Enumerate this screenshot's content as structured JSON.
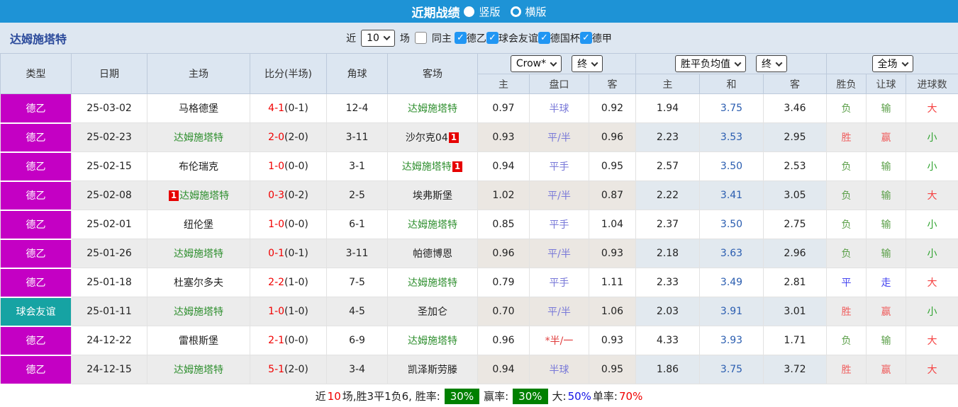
{
  "title_bar": {
    "title": "近期战绩",
    "layout_options": [
      {
        "label": "竖版",
        "selected": true
      },
      {
        "label": "横版",
        "selected": false
      }
    ]
  },
  "filter_bar": {
    "team": "达姆施塔特",
    "recent_label": "近",
    "recent_count": "10",
    "matches_label": "场",
    "same_home_label": "同主",
    "same_home_checked": false,
    "leagues": [
      {
        "label": "德乙",
        "checked": true
      },
      {
        "label": "球会友谊",
        "checked": true
      },
      {
        "label": "德国杯",
        "checked": true
      },
      {
        "label": "德甲",
        "checked": true
      }
    ]
  },
  "table": {
    "headers": {
      "type": "类型",
      "date": "日期",
      "home": "主场",
      "score": "比分(半场)",
      "corner": "角球",
      "away": "客场",
      "odds_company_select": "Crow*",
      "odds_final_select": "终",
      "odds_home": "主",
      "odds_handicap": "盘口",
      "odds_away": "客",
      "avg_select": "胜平负均值",
      "avg_final_select": "终",
      "avg_home": "主",
      "avg_draw": "和",
      "avg_away": "客",
      "result": "胜负",
      "handicap_result": "让球",
      "goals": "进球数",
      "goals_scope_select": "全场"
    },
    "rows": [
      {
        "league": "德乙",
        "league_color": "#c400c4",
        "date": "25-03-02",
        "home": {
          "name": "马格德堡",
          "selected": false,
          "badge": "",
          "badge_pos": ""
        },
        "score_ft": "4-1",
        "score_ht": "(0-1)",
        "corner": "12-4",
        "away": {
          "name": "达姆施塔特",
          "selected": true,
          "badge": "",
          "badge_pos": ""
        },
        "odds": {
          "home": "0.97",
          "handicap": "半球",
          "handicap_red": false,
          "away": "0.92"
        },
        "avg": {
          "home": "1.94",
          "draw": "3.75",
          "away": "3.46"
        },
        "result": {
          "text": "负",
          "color": "green"
        },
        "handicap_result": {
          "text": "输",
          "color": "green"
        },
        "goals": {
          "text": "大",
          "color": "red"
        }
      },
      {
        "league": "德乙",
        "league_color": "#c400c4",
        "date": "25-02-23",
        "home": {
          "name": "达姆施塔特",
          "selected": true,
          "badge": "",
          "badge_pos": ""
        },
        "score_ft": "2-0",
        "score_ht": "(2-0)",
        "corner": "3-11",
        "away": {
          "name": "沙尔克04",
          "selected": false,
          "badge": "1",
          "badge_pos": "after"
        },
        "odds": {
          "home": "0.93",
          "handicap": "平/半",
          "handicap_red": false,
          "away": "0.96"
        },
        "avg": {
          "home": "2.23",
          "draw": "3.53",
          "away": "2.95"
        },
        "result": {
          "text": "胜",
          "color": "red"
        },
        "handicap_result": {
          "text": "赢",
          "color": "red"
        },
        "goals": {
          "text": "小",
          "color": "green"
        }
      },
      {
        "league": "德乙",
        "league_color": "#c400c4",
        "date": "25-02-15",
        "home": {
          "name": "布伦瑞克",
          "selected": false,
          "badge": "",
          "badge_pos": ""
        },
        "score_ft": "1-0",
        "score_ht": "(0-0)",
        "corner": "3-1",
        "away": {
          "name": "达姆施塔特",
          "selected": true,
          "badge": "1",
          "badge_pos": "after"
        },
        "odds": {
          "home": "0.94",
          "handicap": "平手",
          "handicap_red": false,
          "away": "0.95"
        },
        "avg": {
          "home": "2.57",
          "draw": "3.50",
          "away": "2.53"
        },
        "result": {
          "text": "负",
          "color": "green"
        },
        "handicap_result": {
          "text": "输",
          "color": "green"
        },
        "goals": {
          "text": "小",
          "color": "green"
        }
      },
      {
        "league": "德乙",
        "league_color": "#c400c4",
        "date": "25-02-08",
        "home": {
          "name": "达姆施塔特",
          "selected": true,
          "badge": "1",
          "badge_pos": "before"
        },
        "score_ft": "0-3",
        "score_ht": "(0-2)",
        "corner": "2-5",
        "away": {
          "name": "埃弗斯堡",
          "selected": false,
          "badge": "",
          "badge_pos": ""
        },
        "odds": {
          "home": "1.02",
          "handicap": "平/半",
          "handicap_red": false,
          "away": "0.87"
        },
        "avg": {
          "home": "2.22",
          "draw": "3.41",
          "away": "3.05"
        },
        "result": {
          "text": "负",
          "color": "green"
        },
        "handicap_result": {
          "text": "输",
          "color": "green"
        },
        "goals": {
          "text": "大",
          "color": "red"
        }
      },
      {
        "league": "德乙",
        "league_color": "#c400c4",
        "date": "25-02-01",
        "home": {
          "name": "纽伦堡",
          "selected": false,
          "badge": "",
          "badge_pos": ""
        },
        "score_ft": "1-0",
        "score_ht": "(0-0)",
        "corner": "6-1",
        "away": {
          "name": "达姆施塔特",
          "selected": true,
          "badge": "",
          "badge_pos": ""
        },
        "odds": {
          "home": "0.85",
          "handicap": "平手",
          "handicap_red": false,
          "away": "1.04"
        },
        "avg": {
          "home": "2.37",
          "draw": "3.50",
          "away": "2.75"
        },
        "result": {
          "text": "负",
          "color": "green"
        },
        "handicap_result": {
          "text": "输",
          "color": "green"
        },
        "goals": {
          "text": "小",
          "color": "green"
        }
      },
      {
        "league": "德乙",
        "league_color": "#c400c4",
        "date": "25-01-26",
        "home": {
          "name": "达姆施塔特",
          "selected": true,
          "badge": "",
          "badge_pos": ""
        },
        "score_ft": "0-1",
        "score_ht": "(0-1)",
        "corner": "3-11",
        "away": {
          "name": "帕德博恩",
          "selected": false,
          "badge": "",
          "badge_pos": ""
        },
        "odds": {
          "home": "0.96",
          "handicap": "平/半",
          "handicap_red": false,
          "away": "0.93"
        },
        "avg": {
          "home": "2.18",
          "draw": "3.63",
          "away": "2.96"
        },
        "result": {
          "text": "负",
          "color": "green"
        },
        "handicap_result": {
          "text": "输",
          "color": "green"
        },
        "goals": {
          "text": "小",
          "color": "green"
        }
      },
      {
        "league": "德乙",
        "league_color": "#c400c4",
        "date": "25-01-18",
        "home": {
          "name": "杜塞尔多夫",
          "selected": false,
          "badge": "",
          "badge_pos": ""
        },
        "score_ft": "2-2",
        "score_ht": "(1-0)",
        "corner": "7-5",
        "away": {
          "name": "达姆施塔特",
          "selected": true,
          "badge": "",
          "badge_pos": ""
        },
        "odds": {
          "home": "0.79",
          "handicap": "平手",
          "handicap_red": false,
          "away": "1.11"
        },
        "avg": {
          "home": "2.33",
          "draw": "3.49",
          "away": "2.81"
        },
        "result": {
          "text": "平",
          "color": "blue"
        },
        "handicap_result": {
          "text": "走",
          "color": "blue"
        },
        "goals": {
          "text": "大",
          "color": "red"
        }
      },
      {
        "league": "球会友谊",
        "league_color": "#16a3a3",
        "date": "25-01-11",
        "home": {
          "name": "达姆施塔特",
          "selected": true,
          "badge": "",
          "badge_pos": ""
        },
        "score_ft": "1-0",
        "score_ht": "(1-0)",
        "corner": "4-5",
        "away": {
          "name": "圣加仑",
          "selected": false,
          "badge": "",
          "badge_pos": ""
        },
        "odds": {
          "home": "0.70",
          "handicap": "平/半",
          "handicap_red": false,
          "away": "1.06"
        },
        "avg": {
          "home": "2.03",
          "draw": "3.91",
          "away": "3.01"
        },
        "result": {
          "text": "胜",
          "color": "red"
        },
        "handicap_result": {
          "text": "赢",
          "color": "red"
        },
        "goals": {
          "text": "小",
          "color": "green"
        }
      },
      {
        "league": "德乙",
        "league_color": "#c400c4",
        "date": "24-12-22",
        "home": {
          "name": "雷根斯堡",
          "selected": false,
          "badge": "",
          "badge_pos": ""
        },
        "score_ft": "2-1",
        "score_ht": "(0-0)",
        "corner": "6-9",
        "away": {
          "name": "达姆施塔特",
          "selected": true,
          "badge": "",
          "badge_pos": ""
        },
        "odds": {
          "home": "0.96",
          "handicap": "*半/一",
          "handicap_red": true,
          "away": "0.93"
        },
        "avg": {
          "home": "4.33",
          "draw": "3.93",
          "away": "1.71"
        },
        "result": {
          "text": "负",
          "color": "green"
        },
        "handicap_result": {
          "text": "输",
          "color": "green"
        },
        "goals": {
          "text": "大",
          "color": "red"
        }
      },
      {
        "league": "德乙",
        "league_color": "#c400c4",
        "date": "24-12-15",
        "home": {
          "name": "达姆施塔特",
          "selected": true,
          "badge": "",
          "badge_pos": ""
        },
        "score_ft": "5-1",
        "score_ht": "(2-0)",
        "corner": "3-4",
        "away": {
          "name": "凯泽斯劳滕",
          "selected": false,
          "badge": "",
          "badge_pos": ""
        },
        "odds": {
          "home": "0.94",
          "handicap": "半球",
          "handicap_red": false,
          "away": "0.95"
        },
        "avg": {
          "home": "1.86",
          "draw": "3.75",
          "away": "3.72"
        },
        "result": {
          "text": "胜",
          "color": "red"
        },
        "handicap_result": {
          "text": "赢",
          "color": "red"
        },
        "goals": {
          "text": "大",
          "color": "red"
        }
      }
    ]
  },
  "summary": {
    "segments": [
      {
        "text": "近",
        "style": "plain"
      },
      {
        "text": "10",
        "style": "red"
      },
      {
        "text": "场,胜3平1负6, 胜率:",
        "style": "plain"
      },
      {
        "text": "30%",
        "style": "green-badge"
      },
      {
        "text": "赢率:",
        "style": "plain"
      },
      {
        "text": "30%",
        "style": "green-badge"
      },
      {
        "text": "大:",
        "style": "plain"
      },
      {
        "text": "50%",
        "style": "blue"
      },
      {
        "text": "单率:",
        "style": "plain"
      },
      {
        "text": "70%",
        "style": "red"
      }
    ]
  },
  "colors": {
    "titlebar_blue": "#1e93d6",
    "filterbar_bg": "#dee7f1",
    "header_bg": "#dce6f1",
    "league_de2": "#c400c4",
    "league_friendly": "#16a3a3",
    "selected_team_green": "#2f8f2f",
    "score_red": "#f00000",
    "win_red": "#ef5f5f",
    "lose_green": "#5ca04a",
    "draw_blue": "#4646f0",
    "badge_green": "#008000",
    "checkbox_blue": "#2196f3"
  }
}
